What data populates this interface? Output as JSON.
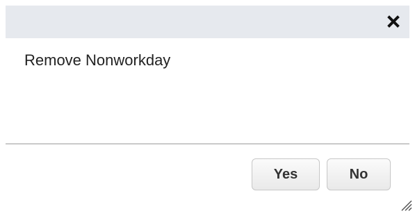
{
  "dialog": {
    "message": "Remove Nonworkday",
    "close_icon": "close-x-icon",
    "buttons": {
      "yes_label": "Yes",
      "no_label": "No"
    },
    "resize_icon": "resize-grip-icon"
  },
  "colors": {
    "titlebar_bg": "#e6e9ee",
    "divider": "#c9c9c9",
    "button_border": "#c7c7c7",
    "text": "#222222"
  }
}
